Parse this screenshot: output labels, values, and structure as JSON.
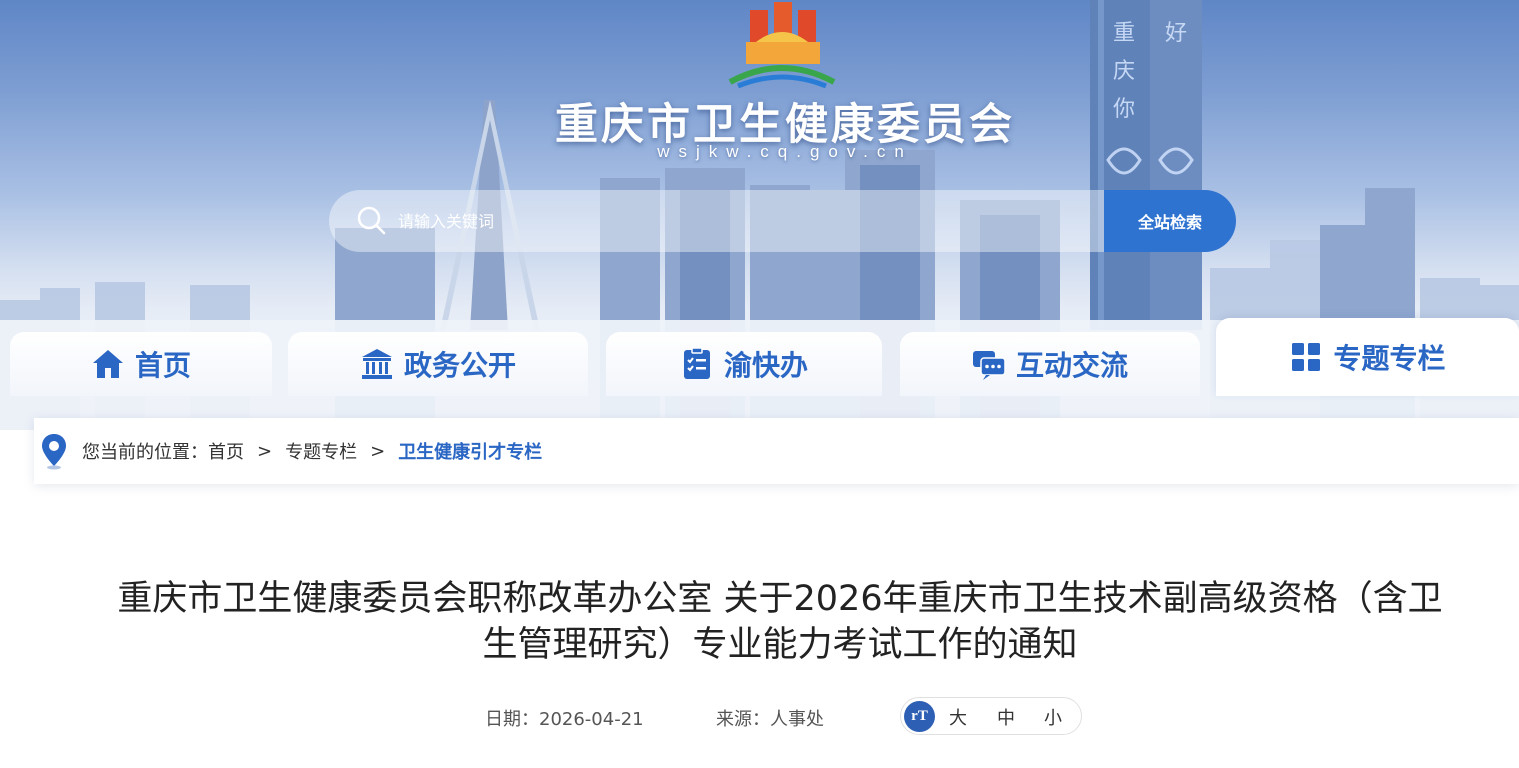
{
  "header": {
    "site_title": "重庆市卫生健康委员会",
    "site_domain": "wsjkw.cq.gov.cn",
    "logo_icon": "chongqing-great-hall-logo",
    "tower_text": "重庆你好"
  },
  "search": {
    "placeholder": "请输入关键词",
    "button_label": "全站检索",
    "icon": "search-icon"
  },
  "nav": {
    "items": [
      {
        "label": "首页",
        "icon": "home-icon"
      },
      {
        "label": "政务公开",
        "icon": "government-building-icon"
      },
      {
        "label": "渝快办",
        "icon": "checklist-icon"
      },
      {
        "label": "互动交流",
        "icon": "chat-bubbles-icon"
      },
      {
        "label": "专题专栏",
        "icon": "grid-squares-icon",
        "active": true
      }
    ]
  },
  "breadcrumb": {
    "prefix": "您当前的位置：",
    "items": [
      "首页",
      "专题专栏",
      "卫生健康引才专栏"
    ],
    "separator": ">"
  },
  "article": {
    "title_line1": "重庆市卫生健康委员会职称改革办公室 关于2026年重庆市卫生技术副高级资格（含卫",
    "title_line2": "生管理研究）专业能力考试工作的通知",
    "date_label": "日期：2026-04-21",
    "source_label": "来源：人事处",
    "font_controls": {
      "icon_text": "rT",
      "large": "大",
      "medium": "中",
      "small": "小"
    }
  },
  "colors": {
    "accent": "#2a66c4",
    "search_button": "#2f73d1",
    "text": "#222222"
  }
}
